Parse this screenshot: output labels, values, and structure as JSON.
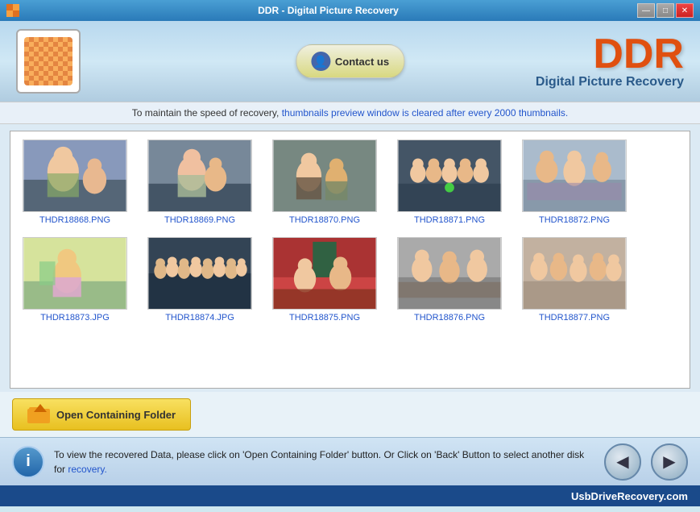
{
  "window": {
    "title": "DDR - Digital Picture Recovery",
    "controls": {
      "minimize": "—",
      "maximize": "□",
      "close": "✕"
    }
  },
  "header": {
    "contact_btn": "Contact us",
    "brand_short": "DDR",
    "brand_full": "Digital Picture Recovery"
  },
  "info_bar": {
    "text_before": "To maintain the speed of recovery, ",
    "highlight": "thumbnails preview window is cleared after every 2000 thumbnails.",
    "text_after": ""
  },
  "thumbnails": [
    {
      "id": 1,
      "name": "THDR18868.PNG",
      "color1": "#8899aa",
      "color2": "#aabbcc",
      "type": "people"
    },
    {
      "id": 2,
      "name": "THDR18869.PNG",
      "color1": "#778899",
      "color2": "#99aabb",
      "type": "people"
    },
    {
      "id": 3,
      "name": "THDR18870.PNG",
      "color1": "#667788",
      "color2": "#8899aa",
      "type": "people"
    },
    {
      "id": 4,
      "name": "THDR18871.PNG",
      "color1": "#556677",
      "color2": "#778899",
      "type": "group"
    },
    {
      "id": 5,
      "name": "THDR18872.PNG",
      "color1": "#aabbcc",
      "color2": "#ccddee",
      "type": "group"
    },
    {
      "id": 6,
      "name": "THDR18873.JPG",
      "color1": "#bbccaa",
      "color2": "#ddeebb",
      "type": "child"
    },
    {
      "id": 7,
      "name": "THDR18874.JPG",
      "color1": "#445566",
      "color2": "#667788",
      "type": "group"
    },
    {
      "id": 8,
      "name": "THDR18875.PNG",
      "color1": "#cc4444",
      "color2": "#ee6666",
      "type": "indoor"
    },
    {
      "id": 9,
      "name": "THDR18876.PNG",
      "color1": "#aaaaaa",
      "color2": "#cccccc",
      "type": "people"
    },
    {
      "id": 10,
      "name": "THDR18877.PNG",
      "color1": "#bbaa99",
      "color2": "#ddccbb",
      "type": "group"
    }
  ],
  "folder_btn": "Open Containing Folder",
  "status": {
    "message_part1": "To view the recovered Data, please click on 'Open Containing Folder' button. Or Click on 'Back' Button to select another disk for",
    "link": "recovery.",
    "info_symbol": "i"
  },
  "footer": {
    "website": "UsbDriveRecovery.com"
  },
  "nav": {
    "back": "◀",
    "forward": "▶"
  }
}
